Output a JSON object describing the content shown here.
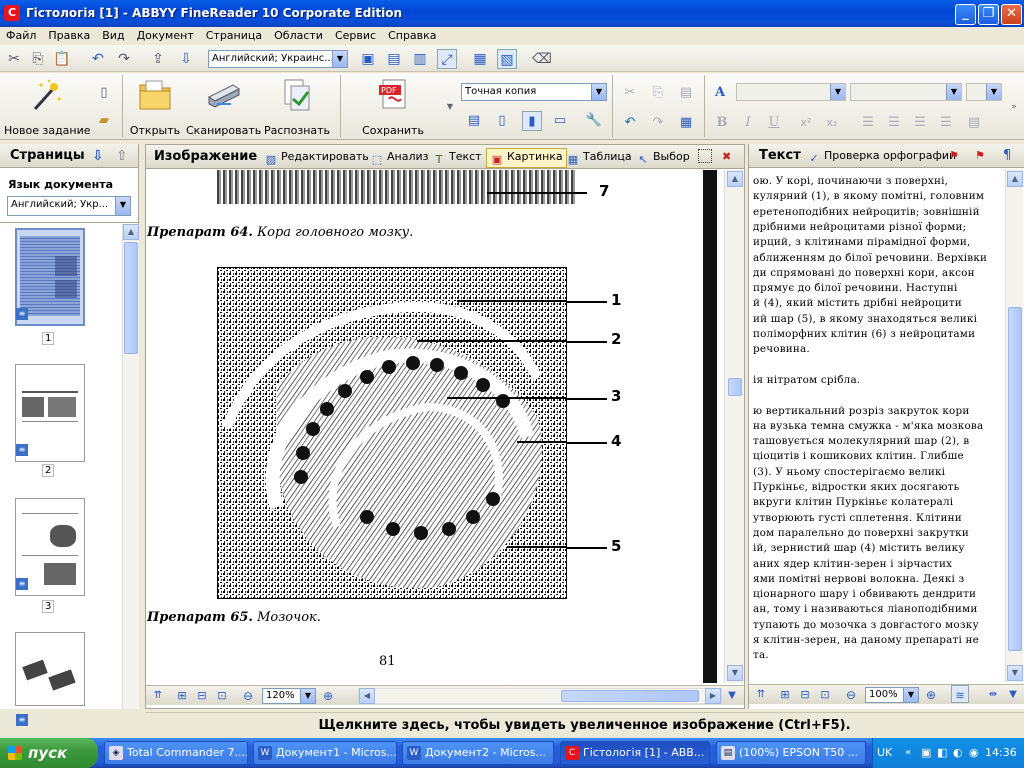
{
  "window": {
    "title": "Гістологія [1] - ABBYY FineReader 10 Corporate Edition",
    "app_icon": "abbyy-logo"
  },
  "menu": [
    "Файл",
    "Правка",
    "Вид",
    "Документ",
    "Страница",
    "Области",
    "Сервис",
    "Справка"
  ],
  "toolbar1": {
    "language_value": "Английский; Украинс..."
  },
  "toolbar2": {
    "new_task": "Новое задание",
    "open": "Открыть",
    "scan": "Сканировать",
    "recognize": "Распознать",
    "save": "Сохранить",
    "save_mode": "Точная копия",
    "format_bold": "B",
    "format_italic": "I",
    "format_underline": "U",
    "format_sup": "x²",
    "format_sub": "x₂"
  },
  "pages_pane": {
    "title": "Страницы",
    "doc_lang_label": "Язык документа",
    "doc_lang_value": "Английский; Укр...",
    "pages": [
      "1",
      "2",
      "3"
    ]
  },
  "image_pane": {
    "title": "Изображение",
    "tools": [
      "Редактировать",
      "Анализ",
      "Текст",
      "Картинка",
      "Таблица",
      "Выбор"
    ],
    "caption_64_num": "Препарат 64.",
    "caption_64_text": " Кора головного мозку.",
    "caption_65_num": "Препарат 65.",
    "caption_65_text": " Мозочок.",
    "labels": [
      "7",
      "1",
      "2",
      "3",
      "4",
      "5"
    ],
    "page_number": "81",
    "zoom": "120%"
  },
  "text_pane": {
    "title": "Текст",
    "spellcheck": "Проверка орфографии",
    "zoom": "100%",
    "lines": [
      "ою.  У  корі,  починаючи  з  поверхні,",
      "кулярний (1), в якому помітні, головним",
      "еретеноподібних  нейроцитів;  зовнішній",
      "дрібними  нейроцитами  різної  форми;",
      "ирций,  з  клітинами  пірамідної  форми,",
      "аближенням до білої речовини. Верхівки",
      "ди  спрямовані до поверхні кори, аксон",
      "  прямує до білої речовини. Наступні",
      "й  (4),  який  містить  дрібні  нейроцити",
      "ий  шар (5),  в  якому  знаходяться  великі",
      "  поліморфних  клітин  (6) з  нейроцитами",
      " речовина.",
      "",
      "ія нітратом срібла.",
      "",
      "ю  вертикальний  розріз  закруток  кори",
      "на вузька темна смужка - м'яка мозкова",
      " ташовується молекулярний шар (2), в",
      "ціоцитів  і  кошикових  клітин.  Глибше",
      "  (3).  У  ньому  спостерігаємо  великі",
      " Пуркіньє,  відростки  яких  досягають",
      "вкруги  клітин  Пуркіньє  колатералі",
      " утворюють  густі  сплетення.  Клітини",
      "дом  паралельно  до  поверхні  закрутки",
      "ій,  зернистий  шар  (4)  містить  велику",
      "аних  ядер  клітин-зерен  і  зірчастих",
      "ями  помітні  нервові  волокна.  Деякі  з",
      "ціонарного шару і обвивають дендрити",
      "ан, тому і називаються ліаноподібними",
      "тупають до мозочка з довгастого мозку",
      "я  клітин-зерен,  на  даному  препараті  не",
      "та."
    ]
  },
  "status": "Щелкните здесь, чтобы увидеть увеличенное изображение (Ctrl+F5).",
  "taskbar": {
    "start": "пуск",
    "tasks": [
      "Total Commander 7....",
      "Документ1 - Micros...",
      "Документ2 - Micros...",
      "Гістологія [1] - АВВ...",
      "(100%) EPSON T50 ..."
    ],
    "lang": "UK",
    "clock": "14:36"
  }
}
